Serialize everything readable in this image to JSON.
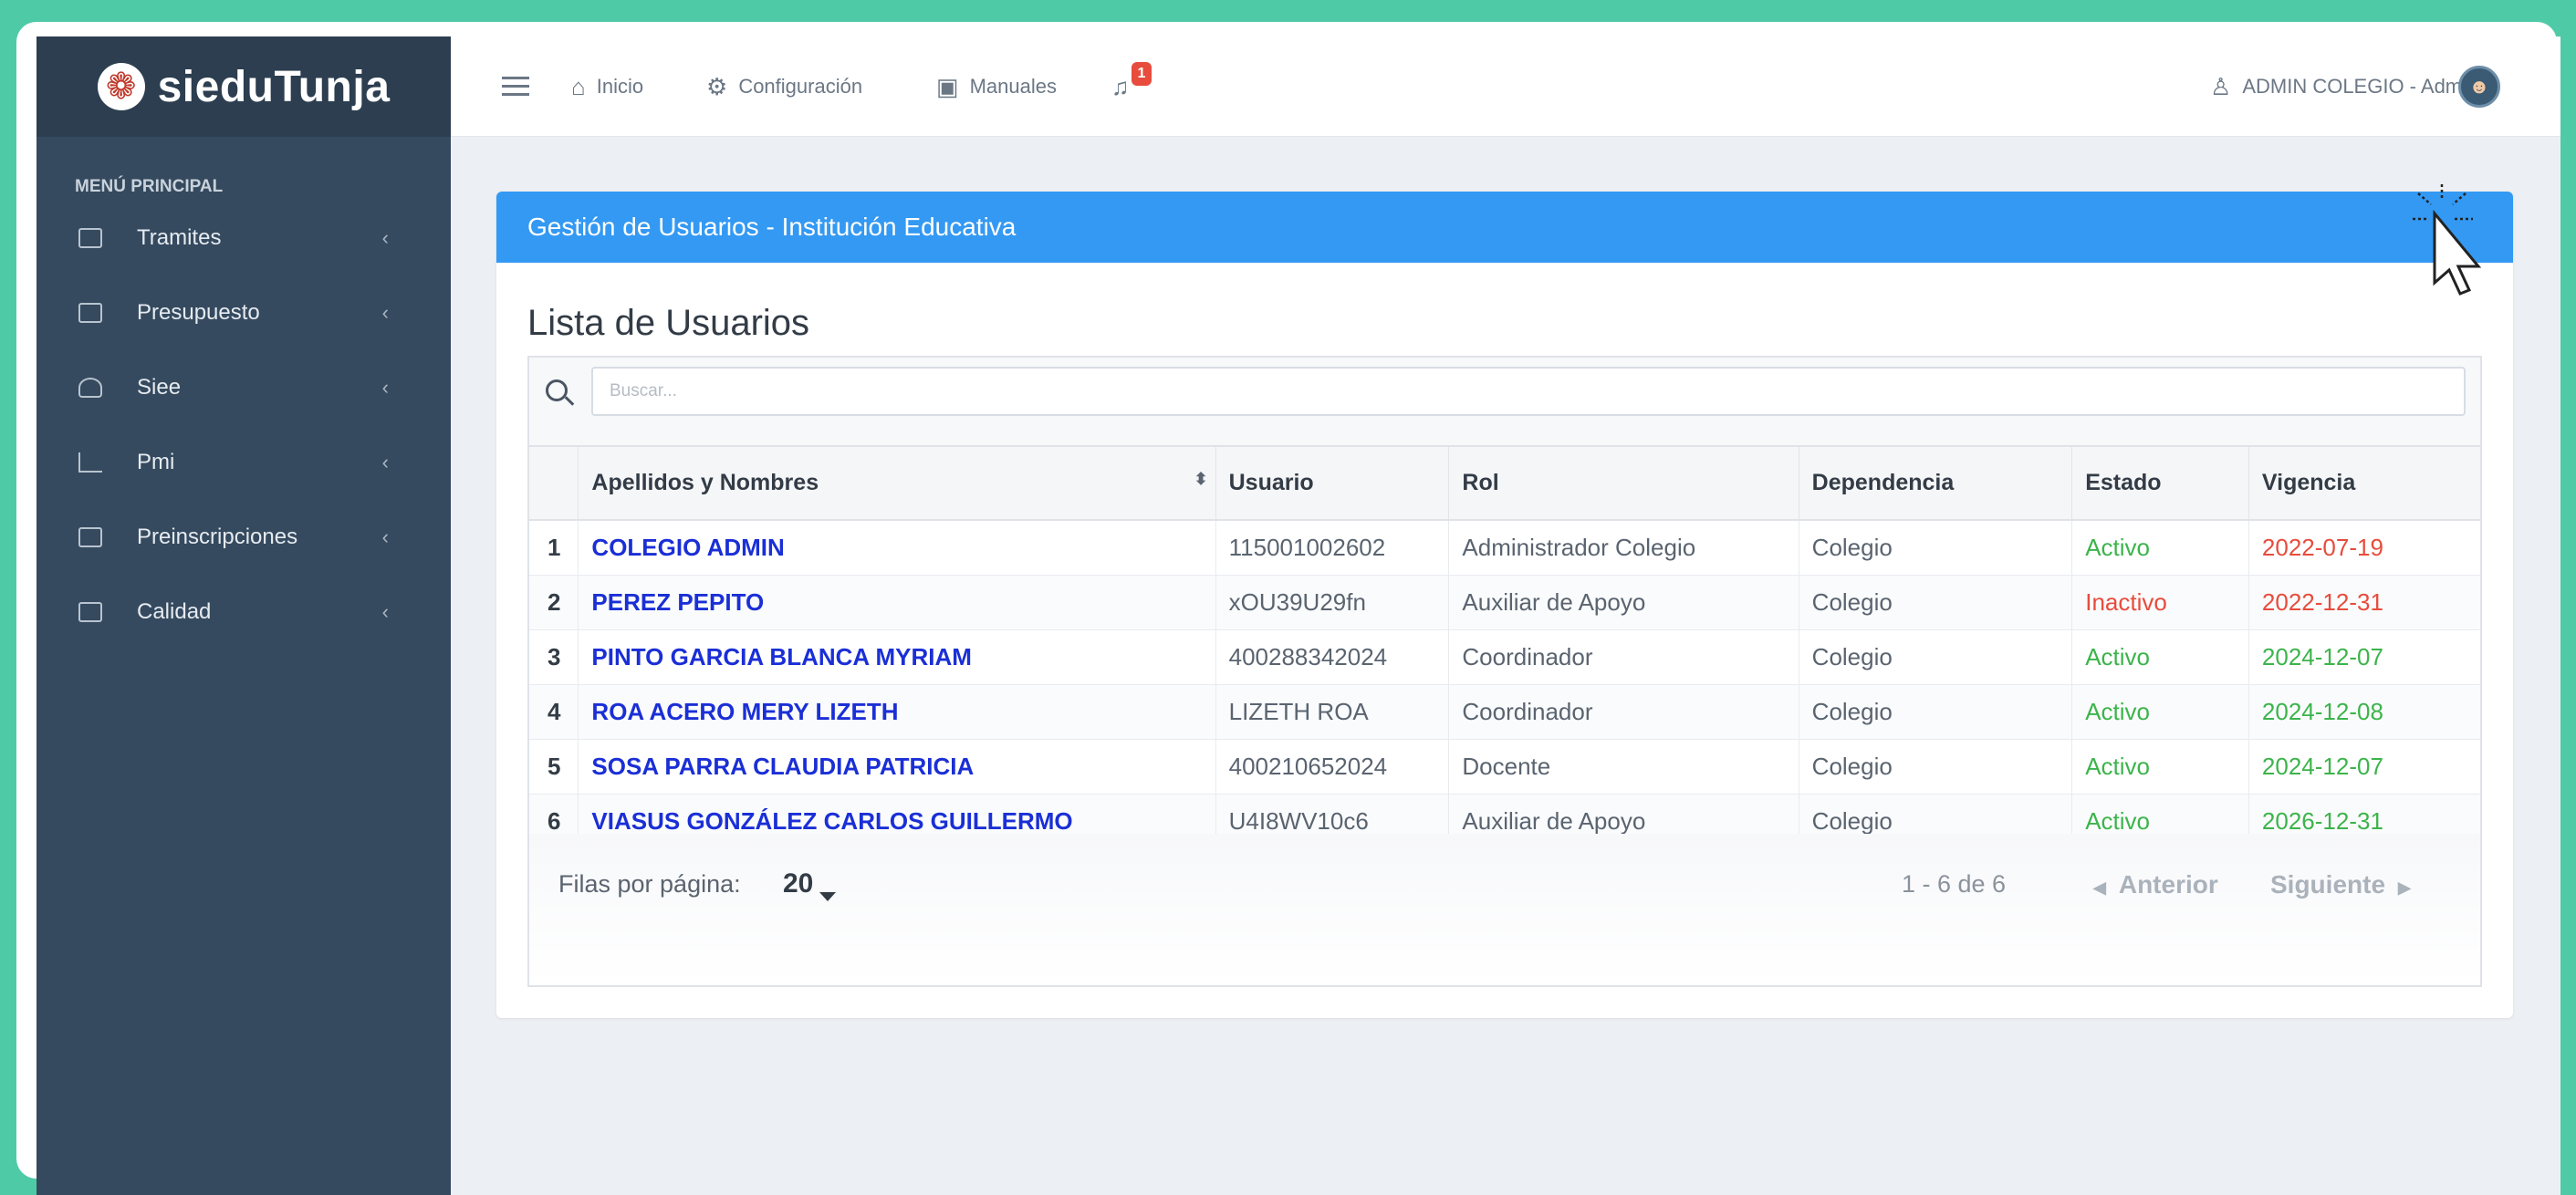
{
  "brand": {
    "name": "sieduTunja"
  },
  "sidebar": {
    "section_title": "MENÚ PRINCIPAL",
    "items": [
      {
        "label": "Tramites",
        "icon": "id-card-icon"
      },
      {
        "label": "Presupuesto",
        "icon": "money-icon"
      },
      {
        "label": "Siee",
        "icon": "layers-icon"
      },
      {
        "label": "Pmi",
        "icon": "chart-line-icon"
      },
      {
        "label": "Preinscripciones",
        "icon": "form-icon"
      },
      {
        "label": "Calidad",
        "icon": "check-square-icon"
      }
    ]
  },
  "topbar": {
    "inicio": "Inicio",
    "configuracion": "Configuración",
    "manuales": "Manuales",
    "notifications_count": "1",
    "user_label": "ADMIN COLEGIO - AdminIE"
  },
  "card": {
    "header": "Gestión de Usuarios - Institución Educativa",
    "list_title": "Lista de Usuarios",
    "search_placeholder": "Buscar..."
  },
  "table": {
    "columns": [
      "Apellidos y Nombres",
      "Usuario",
      "Rol",
      "Dependencia",
      "Estado",
      "Vigencia"
    ],
    "rows": [
      {
        "idx": "1",
        "name": "COLEGIO ADMIN",
        "usuario": "115001002602",
        "rol": "Administrador Colegio",
        "dependencia": "Colegio",
        "estado": "Activo",
        "vigencia": "2022-07-19"
      },
      {
        "idx": "2",
        "name": "PEREZ PEPITO",
        "usuario": "xOU39U29fn",
        "rol": "Auxiliar de Apoyo",
        "dependencia": "Colegio",
        "estado": "Inactivo",
        "vigencia": "2022-12-31"
      },
      {
        "idx": "3",
        "name": "PINTO GARCIA BLANCA MYRIAM",
        "usuario": "400288342024",
        "rol": "Coordinador",
        "dependencia": "Colegio",
        "estado": "Activo",
        "vigencia": "2024-12-07"
      },
      {
        "idx": "4",
        "name": "ROA ACERO MERY LIZETH",
        "usuario": "LIZETH ROA",
        "rol": "Coordinador",
        "dependencia": "Colegio",
        "estado": "Activo",
        "vigencia": "2024-12-08"
      },
      {
        "idx": "5",
        "name": "SOSA PARRA CLAUDIA PATRICIA",
        "usuario": "400210652024",
        "rol": "Docente",
        "dependencia": "Colegio",
        "estado": "Activo",
        "vigencia": "2024-12-07"
      },
      {
        "idx": "6",
        "name": "VIASUS GONZÁLEZ CARLOS GUILLERMO",
        "usuario": "U4I8WV10c6",
        "rol": "Auxiliar de Apoyo",
        "dependencia": "Colegio",
        "estado": "Activo",
        "vigencia": "2026-12-31"
      }
    ]
  },
  "pagination": {
    "rows_label": "Filas por página:",
    "rows_value": "20",
    "range": "1 - 6 de 6",
    "prev": "Anterior",
    "next": "Siguiente"
  },
  "colors": {
    "accent": "#3399f3",
    "sidebar": "#354a5f",
    "frame": "#4ecba6",
    "link": "#1a2fd6",
    "active": "#3cb44b",
    "inactive": "#e74c3c"
  }
}
